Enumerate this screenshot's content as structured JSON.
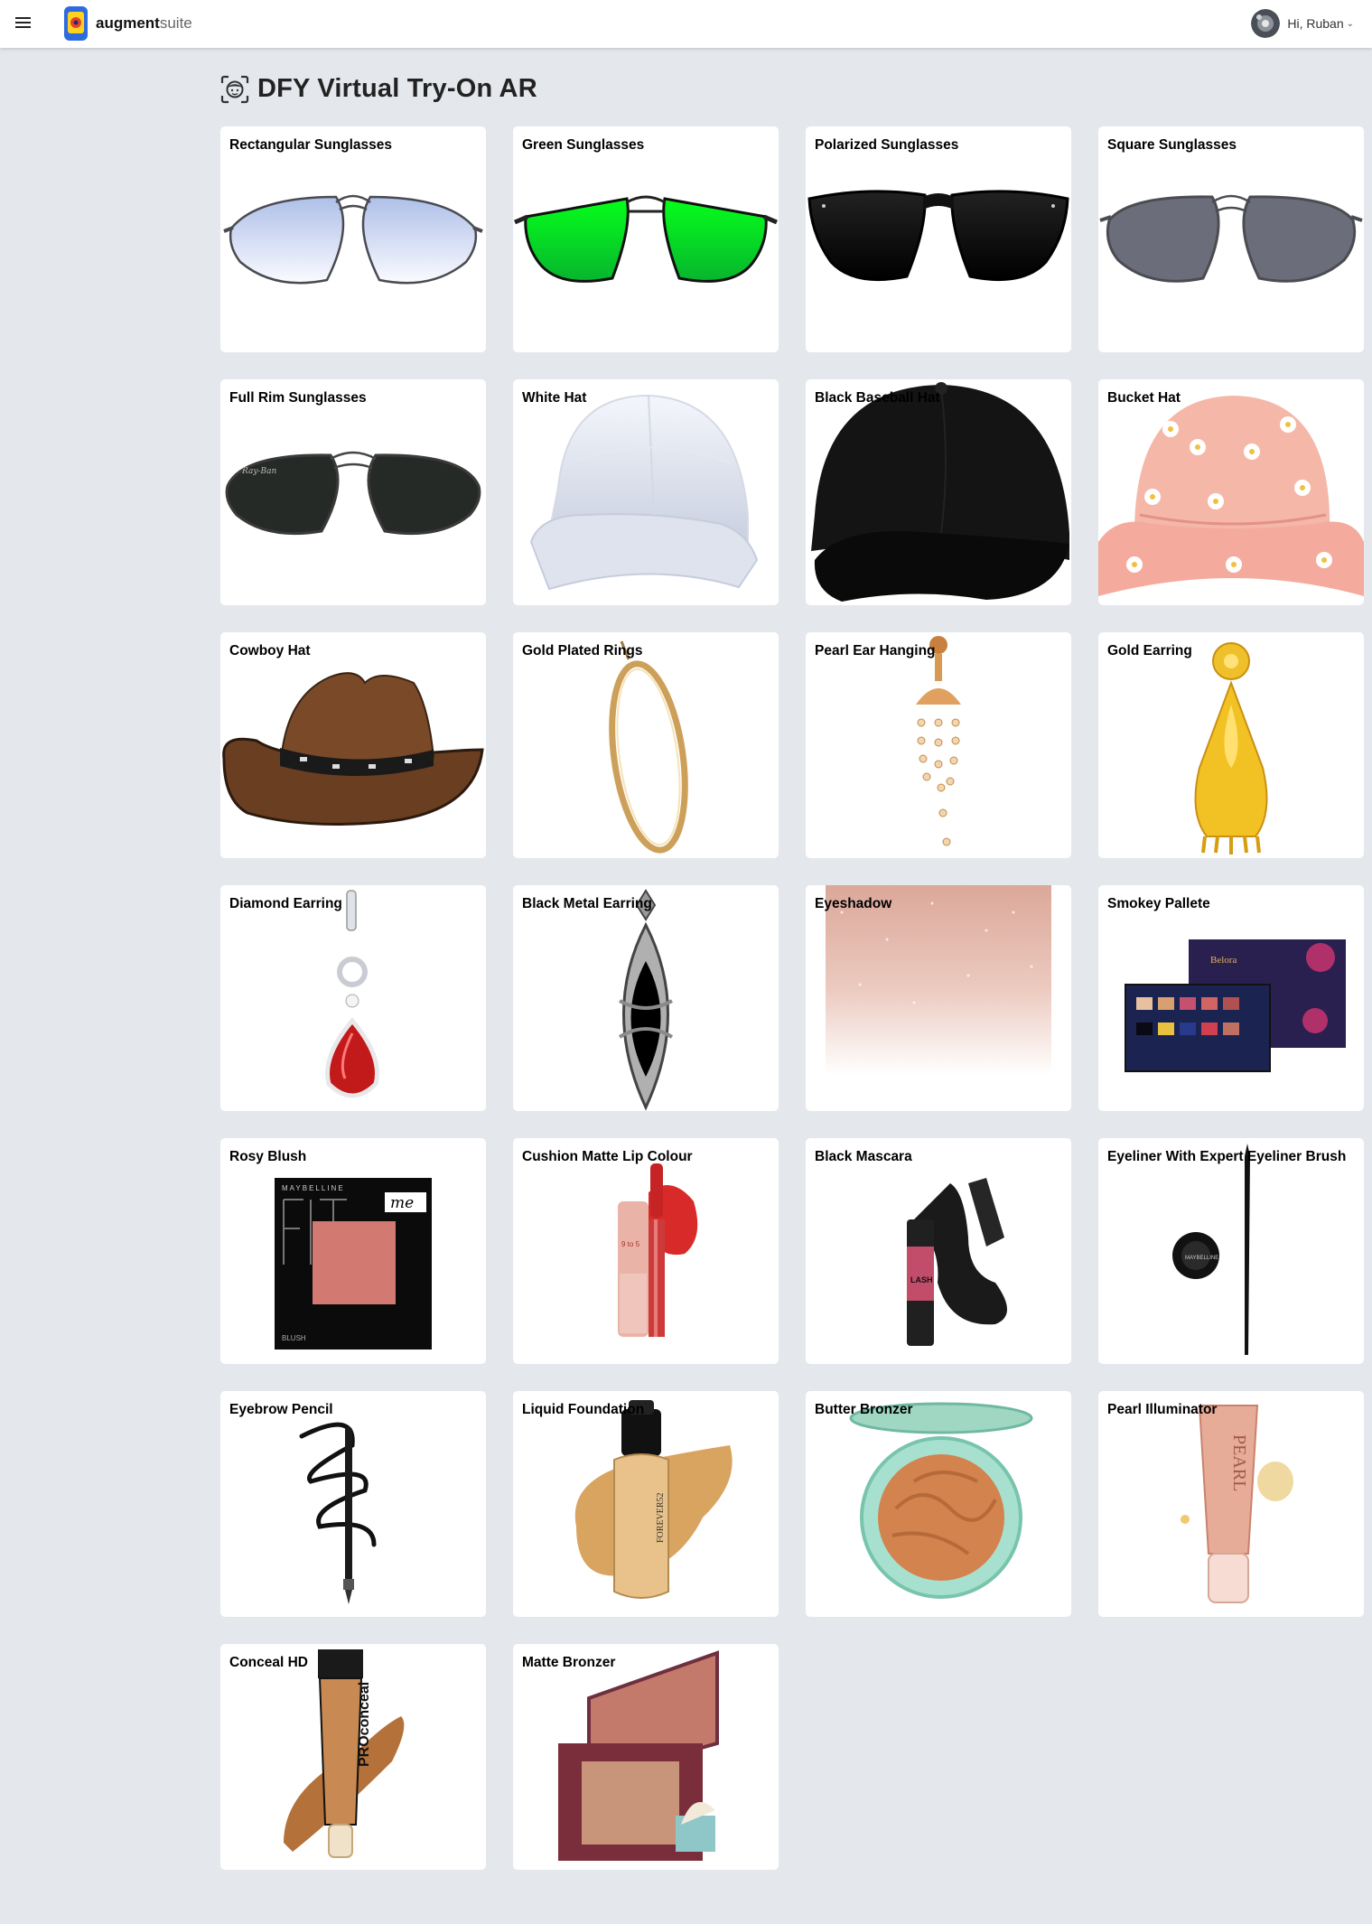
{
  "header": {
    "brand_bold": "augment",
    "brand_light": "suite",
    "greeting": "Hi, Ruban",
    "caret": "⌄"
  },
  "page": {
    "title": "DFY Virtual Try-On AR"
  },
  "products": [
    {
      "label": "Rectangular Sunglasses",
      "icon": "aviator-sunglasses-icon"
    },
    {
      "label": "Green Sunglasses",
      "icon": "green-sunglasses-icon"
    },
    {
      "label": "Polarized Sunglasses",
      "icon": "black-wayfarer-sunglasses-icon"
    },
    {
      "label": "Square Sunglasses",
      "icon": "grey-aviator-sunglasses-icon"
    },
    {
      "label": "Full Rim Sunglasses",
      "icon": "dark-aviator-sunglasses-icon"
    },
    {
      "label": "White Hat",
      "icon": "white-cap-icon"
    },
    {
      "label": "Black Baseball Hat",
      "icon": "black-cap-icon"
    },
    {
      "label": "Bucket Hat",
      "icon": "pink-bucket-hat-icon"
    },
    {
      "label": "Cowboy Hat",
      "icon": "cowboy-hat-icon"
    },
    {
      "label": "Gold Plated Rings",
      "icon": "gold-hoop-icon"
    },
    {
      "label": "Pearl Ear Hanging",
      "icon": "pearl-earring-icon"
    },
    {
      "label": "Gold Earring",
      "icon": "gold-earring-icon"
    },
    {
      "label": "Diamond Earring",
      "icon": "ruby-drop-earring-icon"
    },
    {
      "label": "Black Metal Earring",
      "icon": "black-metal-earring-icon"
    },
    {
      "label": "Eyeshadow",
      "icon": "glitter-swatch-icon"
    },
    {
      "label": "Smokey Pallete",
      "icon": "eyeshadow-palette-icon"
    },
    {
      "label": "Rosy Blush",
      "icon": "blush-compact-icon"
    },
    {
      "label": "Cushion Matte Lip Colour",
      "icon": "lipstick-icon"
    },
    {
      "label": "Black Mascara",
      "icon": "mascara-icon"
    },
    {
      "label": "Eyeliner With Expert Eyeliner Brush",
      "icon": "eyeliner-icon"
    },
    {
      "label": "Eyebrow Pencil",
      "icon": "eyebrow-pencil-icon"
    },
    {
      "label": "Liquid Foundation",
      "icon": "foundation-bottle-icon"
    },
    {
      "label": "Butter Bronzer",
      "icon": "bronzer-compact-icon"
    },
    {
      "label": "Pearl Illuminator",
      "icon": "illuminator-tube-icon"
    },
    {
      "label": "Conceal HD",
      "icon": "concealer-tube-icon"
    },
    {
      "label": "Matte Bronzer",
      "icon": "bronzer-box-icon"
    }
  ]
}
